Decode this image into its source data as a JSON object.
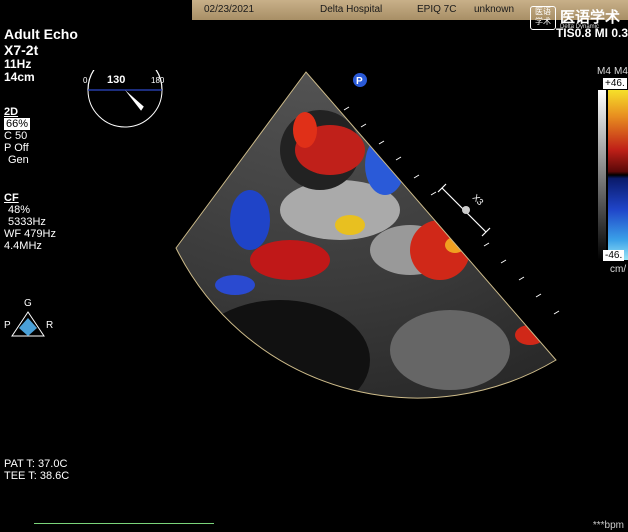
{
  "header": {
    "date": "02/23/2021",
    "hospital": "Delta Hospital",
    "system": "EPIQ 7C",
    "patient": "unknown"
  },
  "logo": {
    "badge_line1": "医语",
    "badge_line2": "学术",
    "text": "医语学术",
    "sub": "Delta Dynamic"
  },
  "probe": {
    "preset": "Adult Echo",
    "transducer": "X7-2t",
    "frame_rate": "11Hz",
    "depth": "14cm"
  },
  "angle": {
    "min": "0",
    "value": "130",
    "max": "180",
    "value_deg": 130
  },
  "mode_2d": {
    "title": "2D",
    "gain": "66%",
    "compression": "C 50",
    "persist": "P Off",
    "res": "Gen"
  },
  "mode_cf": {
    "title": "CF",
    "gain": "48%",
    "freq_prf": "5333Hz",
    "wall_filter": "WF 479Hz",
    "freq": "4.4MHz"
  },
  "indices": "TIS0.8  MI 0.3",
  "orientation": {
    "top": "G",
    "left": "P",
    "right": "R"
  },
  "scale": {
    "label_gray": "M4",
    "label_color": "M4",
    "max": "+46.",
    "min": "-46.",
    "unit": "cm/"
  },
  "temps": {
    "patient": "PAT T: 37.0C",
    "tee": "TEE T: 38.6C"
  },
  "heart_rate": "***bpm",
  "image_marker": "X3",
  "colors": {
    "accent": "#ffffff",
    "info_bar": "#c8b089"
  }
}
